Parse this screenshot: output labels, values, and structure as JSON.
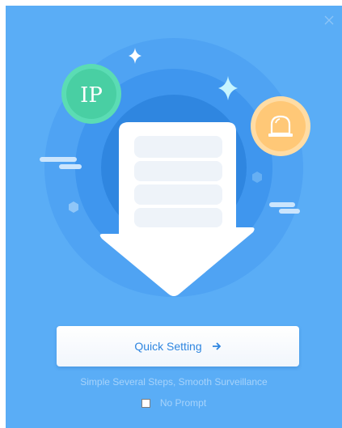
{
  "dialog": {
    "close_icon": "close-icon",
    "ip_badge_text": "IP",
    "quick_setting_label": "Quick Setting",
    "tagline": "Simple Several Steps, Smooth Surveillance",
    "no_prompt_label": "No Prompt",
    "no_prompt_checked": false
  },
  "colors": {
    "background": "#5aadf6",
    "ip_badge": "#5bdcb4",
    "alarm_badge": "#ffc877",
    "button_text": "#2f86e0",
    "muted_text": "#a6d3fb"
  }
}
